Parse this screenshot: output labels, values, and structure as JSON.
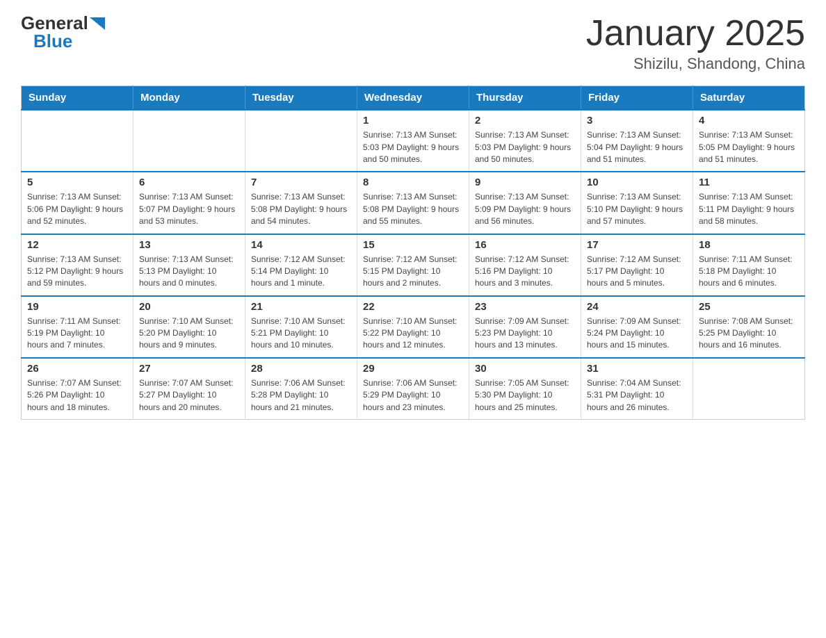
{
  "logo": {
    "general": "General",
    "blue": "Blue",
    "arrow": "▶"
  },
  "title": "January 2025",
  "subtitle": "Shizilu, Shandong, China",
  "weekdays": [
    "Sunday",
    "Monday",
    "Tuesday",
    "Wednesday",
    "Thursday",
    "Friday",
    "Saturday"
  ],
  "weeks": [
    [
      {
        "num": "",
        "info": ""
      },
      {
        "num": "",
        "info": ""
      },
      {
        "num": "",
        "info": ""
      },
      {
        "num": "1",
        "info": "Sunrise: 7:13 AM\nSunset: 5:03 PM\nDaylight: 9 hours and 50 minutes."
      },
      {
        "num": "2",
        "info": "Sunrise: 7:13 AM\nSunset: 5:03 PM\nDaylight: 9 hours and 50 minutes."
      },
      {
        "num": "3",
        "info": "Sunrise: 7:13 AM\nSunset: 5:04 PM\nDaylight: 9 hours and 51 minutes."
      },
      {
        "num": "4",
        "info": "Sunrise: 7:13 AM\nSunset: 5:05 PM\nDaylight: 9 hours and 51 minutes."
      }
    ],
    [
      {
        "num": "5",
        "info": "Sunrise: 7:13 AM\nSunset: 5:06 PM\nDaylight: 9 hours and 52 minutes."
      },
      {
        "num": "6",
        "info": "Sunrise: 7:13 AM\nSunset: 5:07 PM\nDaylight: 9 hours and 53 minutes."
      },
      {
        "num": "7",
        "info": "Sunrise: 7:13 AM\nSunset: 5:08 PM\nDaylight: 9 hours and 54 minutes."
      },
      {
        "num": "8",
        "info": "Sunrise: 7:13 AM\nSunset: 5:08 PM\nDaylight: 9 hours and 55 minutes."
      },
      {
        "num": "9",
        "info": "Sunrise: 7:13 AM\nSunset: 5:09 PM\nDaylight: 9 hours and 56 minutes."
      },
      {
        "num": "10",
        "info": "Sunrise: 7:13 AM\nSunset: 5:10 PM\nDaylight: 9 hours and 57 minutes."
      },
      {
        "num": "11",
        "info": "Sunrise: 7:13 AM\nSunset: 5:11 PM\nDaylight: 9 hours and 58 minutes."
      }
    ],
    [
      {
        "num": "12",
        "info": "Sunrise: 7:13 AM\nSunset: 5:12 PM\nDaylight: 9 hours and 59 minutes."
      },
      {
        "num": "13",
        "info": "Sunrise: 7:13 AM\nSunset: 5:13 PM\nDaylight: 10 hours and 0 minutes."
      },
      {
        "num": "14",
        "info": "Sunrise: 7:12 AM\nSunset: 5:14 PM\nDaylight: 10 hours and 1 minute."
      },
      {
        "num": "15",
        "info": "Sunrise: 7:12 AM\nSunset: 5:15 PM\nDaylight: 10 hours and 2 minutes."
      },
      {
        "num": "16",
        "info": "Sunrise: 7:12 AM\nSunset: 5:16 PM\nDaylight: 10 hours and 3 minutes."
      },
      {
        "num": "17",
        "info": "Sunrise: 7:12 AM\nSunset: 5:17 PM\nDaylight: 10 hours and 5 minutes."
      },
      {
        "num": "18",
        "info": "Sunrise: 7:11 AM\nSunset: 5:18 PM\nDaylight: 10 hours and 6 minutes."
      }
    ],
    [
      {
        "num": "19",
        "info": "Sunrise: 7:11 AM\nSunset: 5:19 PM\nDaylight: 10 hours and 7 minutes."
      },
      {
        "num": "20",
        "info": "Sunrise: 7:10 AM\nSunset: 5:20 PM\nDaylight: 10 hours and 9 minutes."
      },
      {
        "num": "21",
        "info": "Sunrise: 7:10 AM\nSunset: 5:21 PM\nDaylight: 10 hours and 10 minutes."
      },
      {
        "num": "22",
        "info": "Sunrise: 7:10 AM\nSunset: 5:22 PM\nDaylight: 10 hours and 12 minutes."
      },
      {
        "num": "23",
        "info": "Sunrise: 7:09 AM\nSunset: 5:23 PM\nDaylight: 10 hours and 13 minutes."
      },
      {
        "num": "24",
        "info": "Sunrise: 7:09 AM\nSunset: 5:24 PM\nDaylight: 10 hours and 15 minutes."
      },
      {
        "num": "25",
        "info": "Sunrise: 7:08 AM\nSunset: 5:25 PM\nDaylight: 10 hours and 16 minutes."
      }
    ],
    [
      {
        "num": "26",
        "info": "Sunrise: 7:07 AM\nSunset: 5:26 PM\nDaylight: 10 hours and 18 minutes."
      },
      {
        "num": "27",
        "info": "Sunrise: 7:07 AM\nSunset: 5:27 PM\nDaylight: 10 hours and 20 minutes."
      },
      {
        "num": "28",
        "info": "Sunrise: 7:06 AM\nSunset: 5:28 PM\nDaylight: 10 hours and 21 minutes."
      },
      {
        "num": "29",
        "info": "Sunrise: 7:06 AM\nSunset: 5:29 PM\nDaylight: 10 hours and 23 minutes."
      },
      {
        "num": "30",
        "info": "Sunrise: 7:05 AM\nSunset: 5:30 PM\nDaylight: 10 hours and 25 minutes."
      },
      {
        "num": "31",
        "info": "Sunrise: 7:04 AM\nSunset: 5:31 PM\nDaylight: 10 hours and 26 minutes."
      },
      {
        "num": "",
        "info": ""
      }
    ]
  ]
}
